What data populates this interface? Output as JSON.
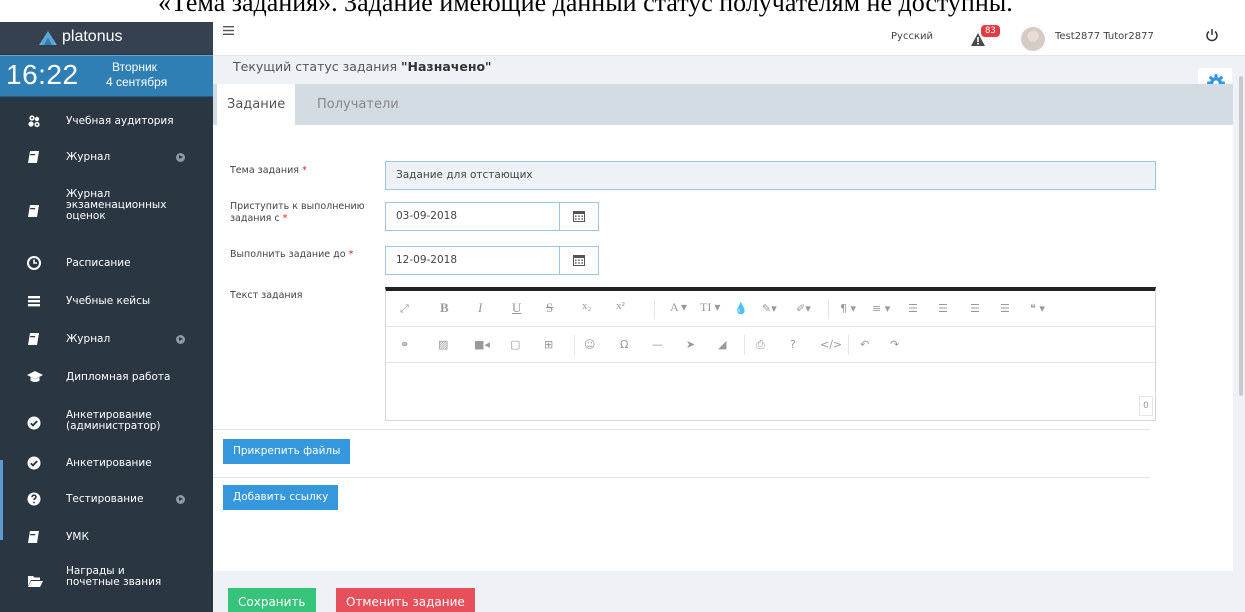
{
  "doc_fragment": "«Тема задания». Задание имеющие данный статус получателям не доступны.",
  "sidebar": {
    "brand": "platonus",
    "clock": {
      "time": "16:22",
      "weekday": "Вторник",
      "date": "4 сентября"
    },
    "items": [
      {
        "label": "Учебная аудитория",
        "icon": "users-icon",
        "arrow": false
      },
      {
        "label": "Журнал",
        "icon": "book-icon",
        "arrow": true
      },
      {
        "label": "Журнал экзаменационных оценок",
        "icon": "book-icon",
        "arrow": false
      },
      {
        "label": "Расписание",
        "icon": "clock-icon",
        "arrow": false
      },
      {
        "label": "Учебные кейсы",
        "icon": "list-icon",
        "arrow": false
      },
      {
        "label": "Журнал",
        "icon": "book-icon",
        "arrow": true
      },
      {
        "label": "Дипломная работа",
        "icon": "graduation-cap-icon",
        "arrow": false
      },
      {
        "label": "Анкетирование (администратор)",
        "icon": "check-circle-icon",
        "arrow": false
      },
      {
        "label": "Анкетирование",
        "icon": "check-circle-icon",
        "arrow": false
      },
      {
        "label": "Тестирование",
        "icon": "question-circle-icon",
        "arrow": true
      },
      {
        "label": "УМК",
        "icon": "book-icon",
        "arrow": false
      },
      {
        "label": "Награды и почетные звания",
        "icon": "folder-open-icon",
        "arrow": false
      }
    ]
  },
  "header": {
    "language": "Русский",
    "notifications_count": "83",
    "username": "Test2877 Tutor2877"
  },
  "main": {
    "status_prefix": "Текущий статус задания ",
    "status_value": "\"Назначено\"",
    "tabs": [
      {
        "label": "Задание",
        "active": true
      },
      {
        "label": "Получатели",
        "active": false
      }
    ],
    "form": {
      "topic_label": "Тема задания",
      "topic_value": "Задание для отстающих",
      "start_label": "Приступить к выполнению задания с",
      "start_value": "03-09-2018",
      "due_label": "Выполнить задание до",
      "due_value": "12-09-2018",
      "text_label": "Текст задания",
      "required_mark": "*",
      "char_count": "0"
    },
    "buttons": {
      "attach_files": "Прикрепить файлы",
      "add_link": "Добавить ссылку",
      "save": "Сохранить",
      "cancel_task": "Отменить задание"
    }
  },
  "colors": {
    "sidebar_bg": "#2b3643",
    "clock_bg": "#2f7fb5",
    "accent_blue": "#3598dc",
    "save_green": "#36c47a",
    "cancel_red": "#e7505a",
    "badge_red": "#e43a45"
  }
}
